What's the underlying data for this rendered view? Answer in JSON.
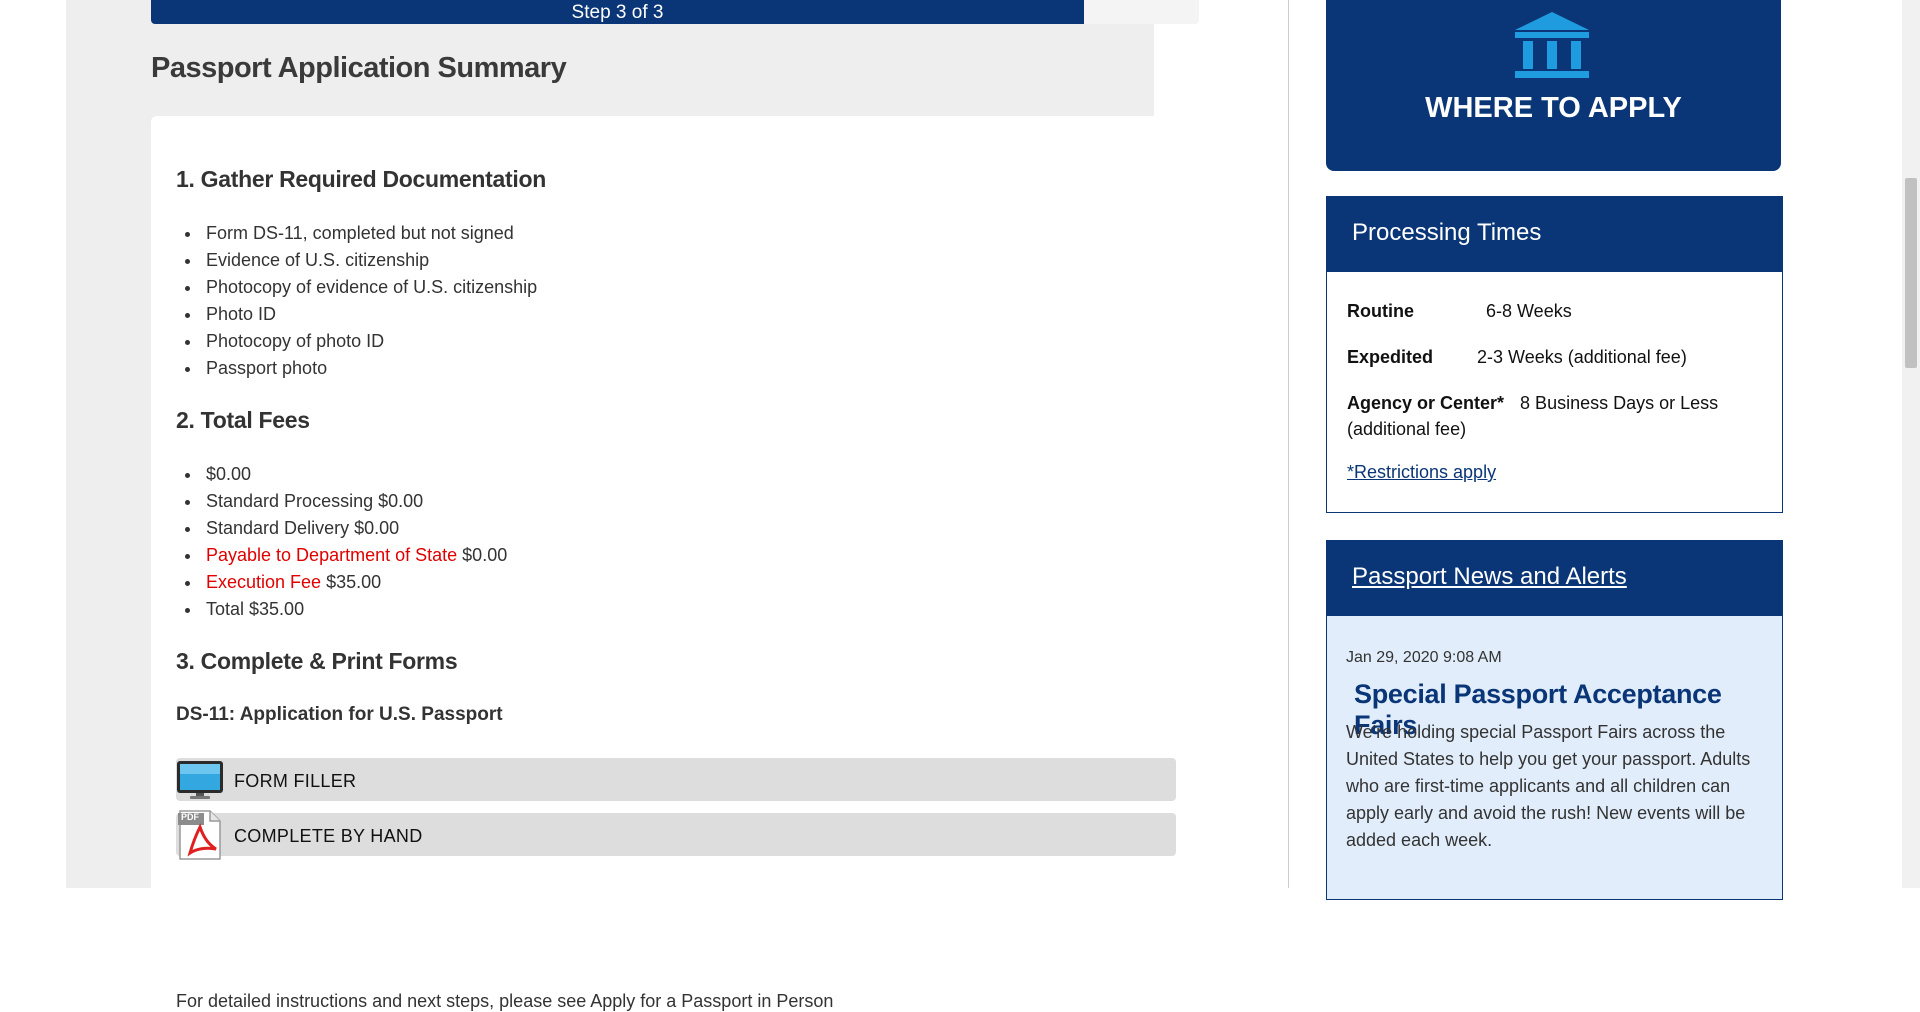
{
  "progress": {
    "label": "Step 3 of 3",
    "percent": 89
  },
  "page_title": "Passport Application Summary",
  "sections": {
    "documents": {
      "heading": "1. Gather Required Documentation",
      "items": [
        "Form DS-11, completed but not signed",
        "Evidence of U.S. citizenship",
        "Photocopy of evidence of U.S. citizenship",
        "Photo ID",
        "Photocopy of photo ID",
        "Passport photo"
      ]
    },
    "fees": {
      "heading": "2. Total Fees",
      "total_top": "$0.00",
      "standard_processing": "Standard Processing $0.00",
      "standard_delivery": "Standard Delivery $0.00",
      "payable_label": "Payable to Department of State",
      "payable_value": "$0.00",
      "execution_label": "Execution Fee",
      "execution_value": "$35.00",
      "total": "Total $35.00"
    },
    "forms": {
      "heading": "3. Complete & Print Forms",
      "form_title": "DS-11: Application for U.S. Passport",
      "form_filler_label": "FORM FILLER",
      "by_hand_label": "COMPLETE BY HAND",
      "pdf_badge": "PDF",
      "cut_off_text": "For detailed instructions and next steps, please see Apply for a Passport in Person"
    }
  },
  "sidebar": {
    "apply_tile": {
      "label": "WHERE TO APPLY",
      "icon": "bank-icon"
    },
    "processing": {
      "title": "Processing Times",
      "routine_label": "Routine",
      "routine_value": "6-8 Weeks",
      "expedited_label": "Expedited",
      "expedited_value": "2-3 Weeks (additional fee)",
      "agency_label": "Agency or Center*",
      "agency_value": "8 Business Days or Less",
      "agency_note": "(additional fee)",
      "restrictions_link": "*Restrictions apply"
    },
    "news": {
      "title": "Passport News and Alerts",
      "date": "Jan 29, 2020 9:08 AM",
      "headline": "Special Passport Acceptance Fairs",
      "body": "We're holding special Passport Fairs across the United States to help you get your passport. Adults who are first-time applicants and all children can apply early and avoid the rush! New events will be added each week."
    }
  },
  "colors": {
    "navy": "#0a3677",
    "light_blue_panel": "#e1edfa",
    "fee_red": "#e00000",
    "icon_blue": "#1f9be0"
  }
}
